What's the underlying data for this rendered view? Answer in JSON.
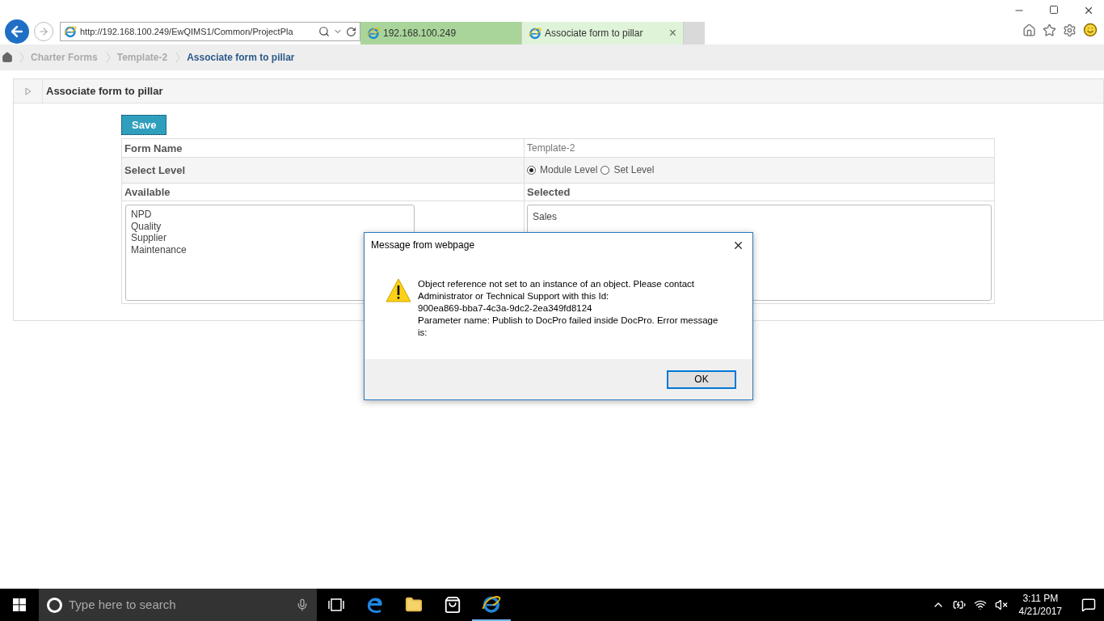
{
  "browser": {
    "address": "http://192.168.100.249/EwQIMS1/Common/ProjectPla",
    "tabs": [
      {
        "label": "192.168.100.249",
        "selected": false
      },
      {
        "label": "Associate form to pillar",
        "selected": true
      }
    ],
    "close_tab": "×"
  },
  "breadcrumb": [
    {
      "label": "Charter Forms",
      "current": false
    },
    {
      "label": "Template-2",
      "current": false
    },
    {
      "label": "Associate form to pillar",
      "current": true
    }
  ],
  "panel": {
    "title": "Associate form to pillar",
    "save": "Save",
    "form_name_label": "Form Name",
    "form_name": "Template-2",
    "level_label": "Select Level",
    "levels": [
      {
        "label": "Module Level",
        "selected": true
      },
      {
        "label": "Set Level",
        "selected": false
      }
    ],
    "available_label": "Available",
    "available": [
      "NPD",
      "Quality",
      "Supplier",
      "Maintenance"
    ],
    "selected_label": "Selected",
    "selected_items": [
      "Sales"
    ]
  },
  "dialog": {
    "title": "Message from webpage",
    "lines": [
      "Object reference not set to an instance of an object. Please contact Administrator or Technical Support with this Id:",
      "900ea869-bba7-4c3a-9dc2-2ea349fd8124",
      "Parameter name: Publish to DocPro failed inside DocPro. Error message is:"
    ],
    "ok": "OK"
  },
  "taskbar": {
    "search_placeholder": "Type here to search",
    "time": "3:11 PM",
    "date": "4/21/2017"
  }
}
